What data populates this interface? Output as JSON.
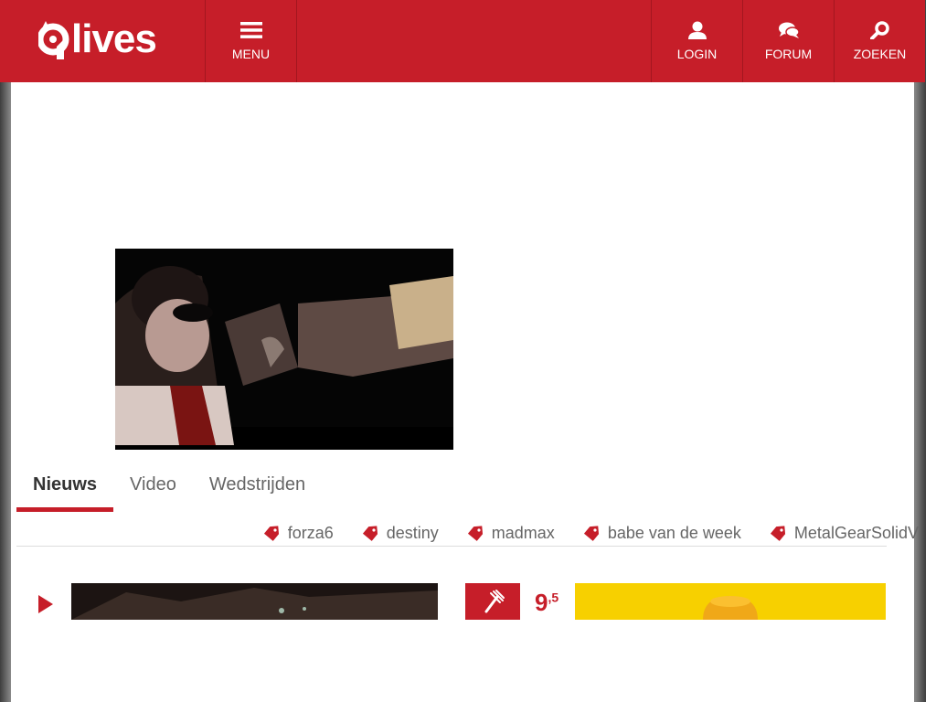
{
  "header": {
    "logo_text": "lives",
    "menu_label": "MENU",
    "login_label": "LOGIN",
    "forum_label": "FORUM",
    "search_label": "ZOEKEN"
  },
  "tabs": [
    {
      "label": "Nieuws",
      "active": true
    },
    {
      "label": "Video",
      "active": false
    },
    {
      "label": "Wedstrijden",
      "active": false
    }
  ],
  "tags": [
    "forza6",
    "destiny",
    "madmax",
    "babe van de week",
    "MetalGearSolidV"
  ],
  "review": {
    "score_main": "9",
    "score_decimal": ",5"
  },
  "colors": {
    "brand": "#c61e29",
    "text": "#333333",
    "muted": "#666666"
  }
}
